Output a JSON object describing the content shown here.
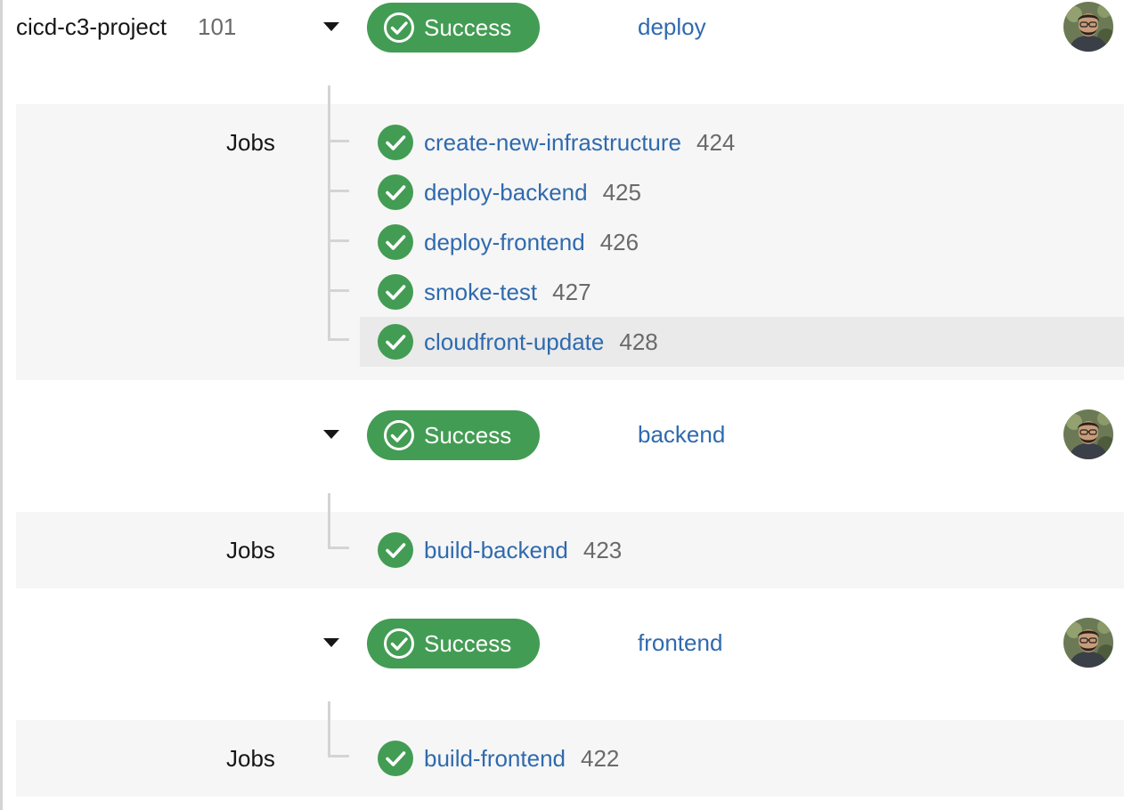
{
  "project": {
    "name": "cicd-c3-project",
    "number": "101"
  },
  "jobs_label": "Jobs",
  "colors": {
    "success": "#439c53",
    "link": "#2f6aae",
    "muted": "#6a6a6a",
    "band": "#f6f6f6"
  },
  "workflows": [
    {
      "status": "Success",
      "name": "deploy",
      "expanded": true,
      "jobs": [
        {
          "name": "create-new-infrastructure",
          "number": "424",
          "status": "success"
        },
        {
          "name": "deploy-backend",
          "number": "425",
          "status": "success"
        },
        {
          "name": "deploy-frontend",
          "number": "426",
          "status": "success"
        },
        {
          "name": "smoke-test",
          "number": "427",
          "status": "success"
        },
        {
          "name": "cloudfront-update",
          "number": "428",
          "status": "success"
        }
      ]
    },
    {
      "status": "Success",
      "name": "backend",
      "expanded": true,
      "jobs": [
        {
          "name": "build-backend",
          "number": "423",
          "status": "success"
        }
      ]
    },
    {
      "status": "Success",
      "name": "frontend",
      "expanded": true,
      "jobs": [
        {
          "name": "build-frontend",
          "number": "422",
          "status": "success"
        }
      ]
    }
  ],
  "icons": {
    "status": "check-circle-icon",
    "toggle": "caret-down-icon",
    "avatar": "user-avatar"
  }
}
